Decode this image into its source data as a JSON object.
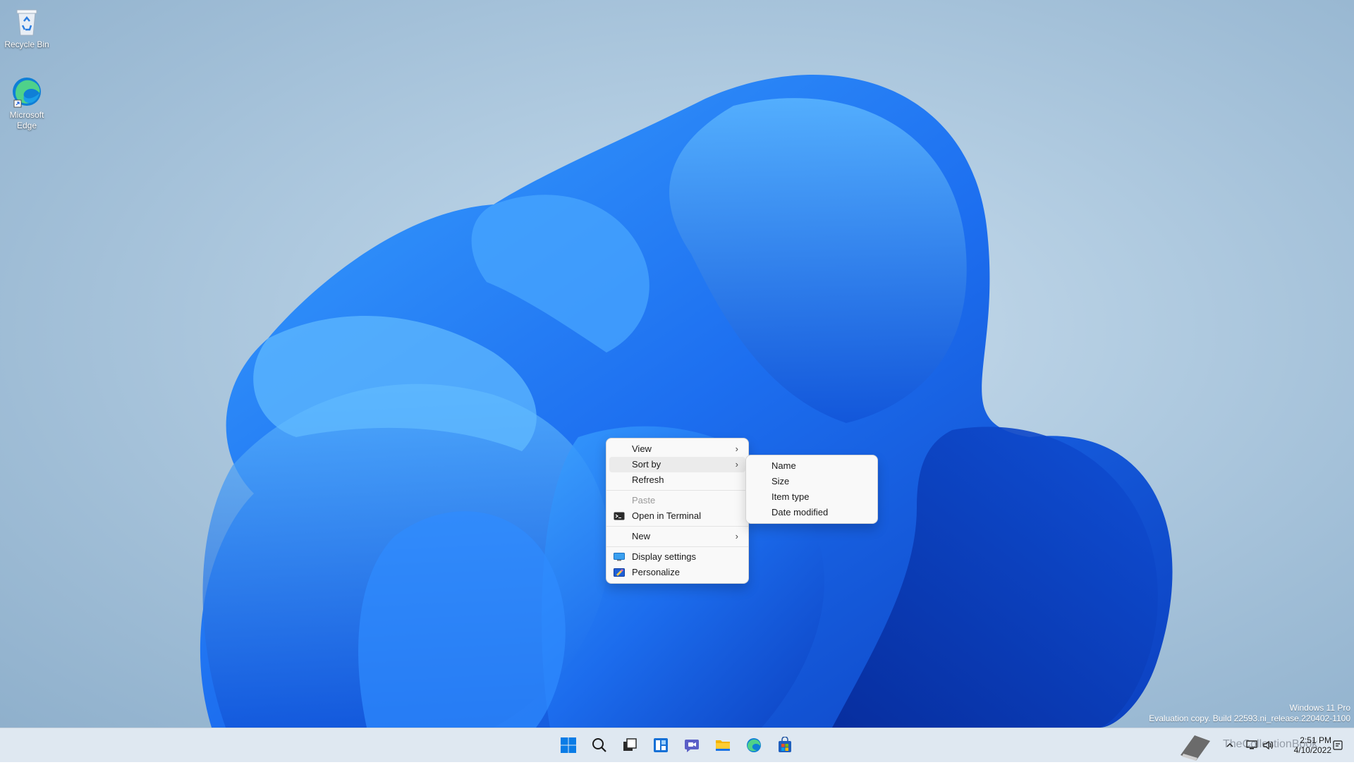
{
  "desktop": {
    "icons": [
      {
        "label": "Recycle Bin",
        "icon": "recycle-bin-icon"
      },
      {
        "label": "Microsoft Edge",
        "icon": "edge-icon"
      }
    ],
    "watermark": {
      "edition": "Windows 11 Pro",
      "build": "Evaluation copy. Build 22593.ni_release.220402-1100"
    },
    "site_watermark": "TheCollectionBook"
  },
  "context_menu": {
    "items": [
      {
        "label": "View",
        "submenu": true
      },
      {
        "label": "Sort by",
        "submenu": true
      },
      {
        "label": "Refresh"
      },
      {
        "label": "Paste",
        "disabled": true
      },
      {
        "label": "Open in Terminal",
        "icon": "terminal-icon"
      },
      {
        "label": "New",
        "submenu": true
      },
      {
        "label": "Display settings",
        "icon": "display-icon"
      },
      {
        "label": "Personalize",
        "icon": "personalize-icon"
      }
    ],
    "arrow": "›"
  },
  "sort_submenu": {
    "items": [
      {
        "label": "Name"
      },
      {
        "label": "Size"
      },
      {
        "label": "Item type"
      },
      {
        "label": "Date modified"
      }
    ]
  },
  "taskbar": {
    "apps": [
      "start-icon",
      "search-icon",
      "task-view-icon",
      "widgets-icon",
      "chat-icon",
      "file-explorer-icon",
      "edge-icon",
      "store-icon"
    ],
    "tray": {
      "time": "2:51 PM",
      "date": "4/10/2022",
      "icons": [
        "chevron-up-icon",
        "network-icon",
        "volume-icon"
      ]
    }
  },
  "colors": {
    "accent": "#0067c0",
    "menu_bg": "#f9f9f9",
    "taskbar_bg": "#dfe8f1"
  }
}
